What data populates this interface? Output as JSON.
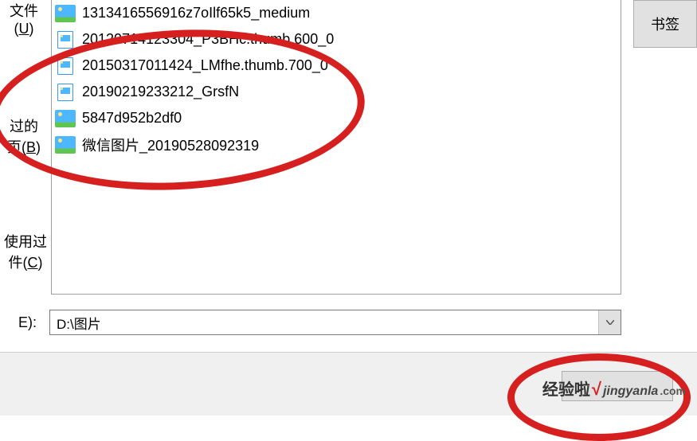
{
  "sidebar": {
    "label1_line1": "文件",
    "label1_key": "U",
    "label1_close": ")",
    "label2_line1": "过的",
    "label2_line2_pre": "页(",
    "label2_key": "B",
    "label2_close": ")",
    "label3_line1": "使用过",
    "label3_line2_pre": "件(",
    "label3_key": "C",
    "label3_close": ")"
  },
  "right_panel": {
    "bookmark_label": "书签"
  },
  "files": [
    {
      "icon": "large",
      "name": "1313416556916z7oIlf65k5_medium"
    },
    {
      "icon": "small",
      "name": "20120714123304_P3BHc.thumb.600_0"
    },
    {
      "icon": "small",
      "name": "20150317011424_LMfhe.thumb.700_0"
    },
    {
      "icon": "small",
      "name": "20190219233212_GrsfN"
    },
    {
      "icon": "large",
      "name": "5847d952b2df0"
    },
    {
      "icon": "large",
      "name": "微信图片_20190528092319"
    }
  ],
  "path_row": {
    "label": "E):",
    "value": "D:\\图片"
  },
  "watermark": {
    "text_zh": "经验啦",
    "text_en": "jingyanla",
    "text_com": ".com"
  }
}
